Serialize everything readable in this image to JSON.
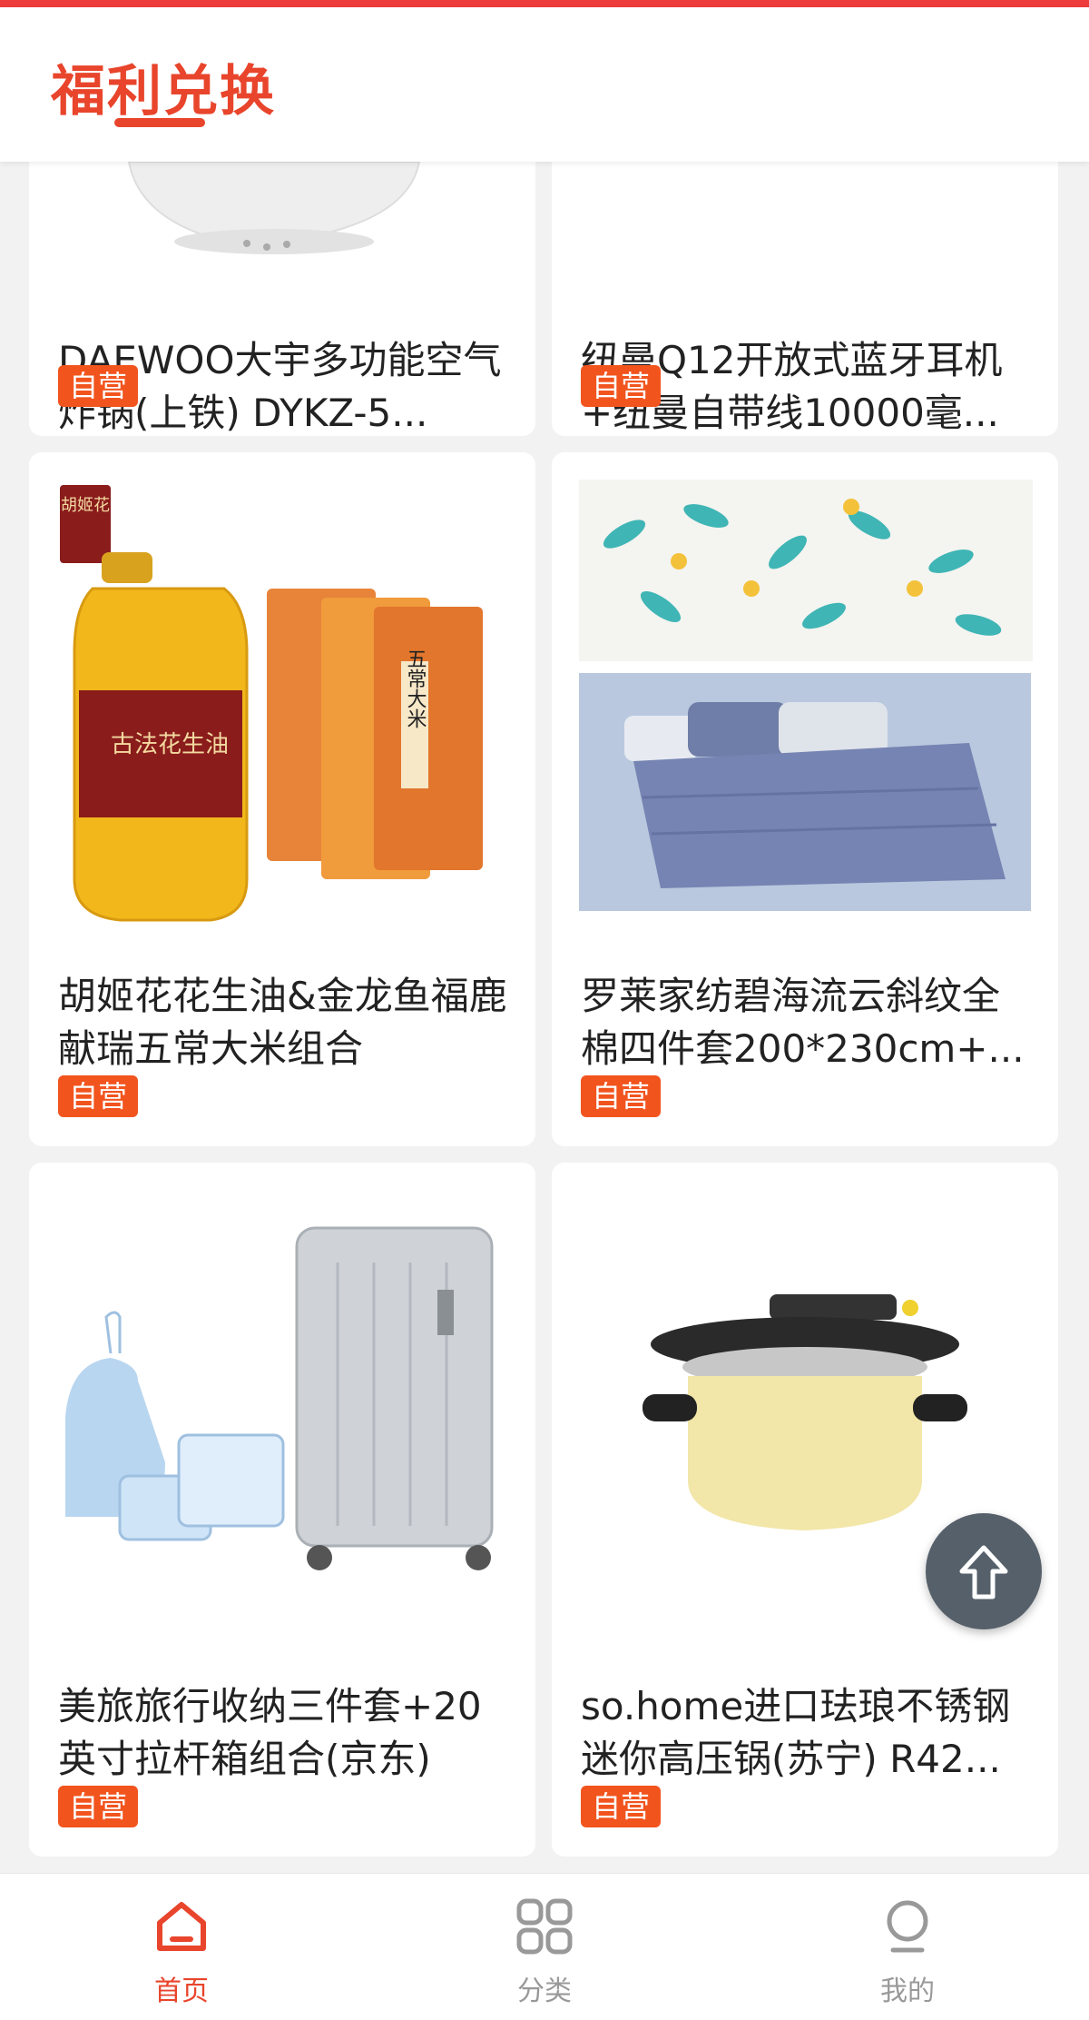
{
  "header": {
    "title": "福利兑换"
  },
  "colors": {
    "accent": "#e8452c",
    "badge": "#f2541e",
    "text": "#222222",
    "tab_inactive": "#999999"
  },
  "products": [
    {
      "title": "DAEWOO大宇多功能空气炸锅(上铁) DYKZ-5...",
      "badge": "自营",
      "image": "air-fryer"
    },
    {
      "title": "纽曼Q12开放式蓝牙耳机+纽曼自带线10000毫...",
      "badge": "自营",
      "image": "earbuds-powerbank"
    },
    {
      "title": "胡姬花花生油&金龙鱼福鹿献瑞五常大米组合",
      "badge": "自营",
      "image": "peanut-oil-rice",
      "image_text": {
        "brand": "胡姬花",
        "bottle": "古法花生油",
        "rice": "五常大米"
      }
    },
    {
      "title": "罗莱家纺碧海流云斜纹全棉四件套200*230cm+...",
      "badge": "自营",
      "image": "bedding-set"
    },
    {
      "title": "美旅旅行收纳三件套+20英寸拉杆箱组合(京东)",
      "badge": "自营",
      "image": "luggage-set"
    },
    {
      "title": "so.home进口珐琅不锈钢迷你高压锅(苏宁) R42...",
      "badge": "自营",
      "image": "pressure-cooker"
    }
  ],
  "tabbar": [
    {
      "label": "首页",
      "icon": "home-icon",
      "active": true
    },
    {
      "label": "分类",
      "icon": "grid-icon",
      "active": false
    },
    {
      "label": "我的",
      "icon": "user-icon",
      "active": false
    }
  ],
  "fab": {
    "icon": "back-to-top-icon"
  }
}
